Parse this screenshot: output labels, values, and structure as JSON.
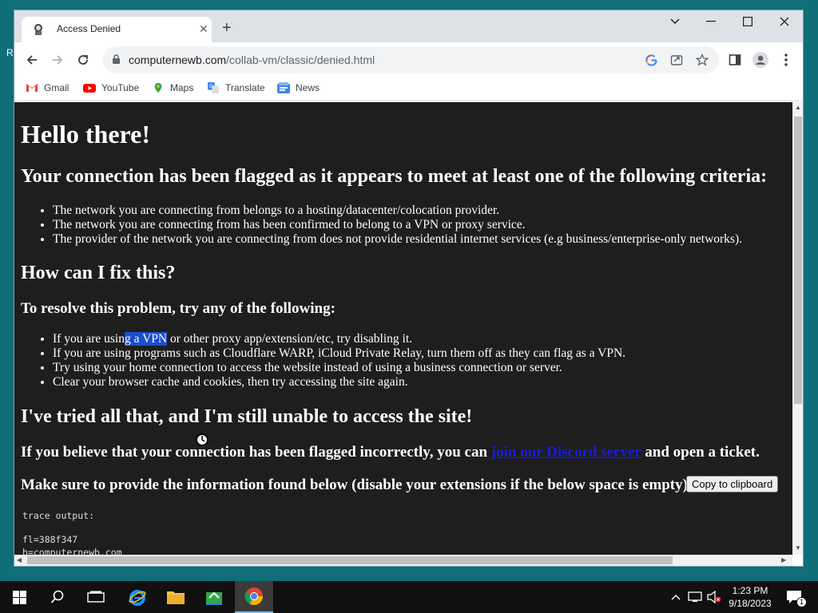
{
  "desktop": {
    "fragment_r": "R"
  },
  "browser": {
    "tab": {
      "title": "Access Denied",
      "close": "✕"
    },
    "new_tab": "+",
    "window_controls": {
      "dropdown": "⌄",
      "minimize": "—",
      "maximize": "☐",
      "close": "✕"
    },
    "url_host": "computernewb.com",
    "url_path": "/collab-vm/classic/denied.html",
    "bookmarks": [
      {
        "label": "Gmail",
        "icon": "gmail-icon"
      },
      {
        "label": "YouTube",
        "icon": "youtube-icon"
      },
      {
        "label": "Maps",
        "icon": "maps-icon"
      },
      {
        "label": "Translate",
        "icon": "translate-icon"
      },
      {
        "label": "News",
        "icon": "news-icon"
      }
    ]
  },
  "page": {
    "heading": "Hello there!",
    "flagged_heading": "Your connection has been flagged as it appears to meet at least one of the following criteria:",
    "criteria": [
      "The network you are connecting from belongs to a hosting/datacenter/colocation provider.",
      "The network you are connecting from has been confirmed to belong to a VPN or proxy service.",
      "The provider of the network you are connecting from does not provide residential internet services (e.g business/enterprise-only networks)."
    ],
    "fix_heading": "How can I fix this?",
    "resolve_heading": "To resolve this problem, try any of the following:",
    "fix_item1_pre": "If you are usin",
    "fix_item1_sel": "g a VPN",
    "fix_item1_post": " or other proxy app/extension/etc, try disabling it.",
    "fixes": [
      "If you are using programs such as Cloudflare WARP, iCloud Private Relay, turn them off as they can flag as a VPN.",
      "Try using your home connection to access the website instead of using a business connection or server.",
      "Clear your browser cache and cookies, then try accessing the site again."
    ],
    "tried_heading": "I've tried all that, and I'm still unable to access the site!",
    "ticket_pre": "If you believe that your connection has been flagged incorrectly, you can ",
    "ticket_link": "join our Discord server",
    "ticket_post": " and open a ticket.",
    "info_text": "Make sure to provide the information found below (disable your extensions if the below space is empty):",
    "copy_button": "Copy to clipboard",
    "trace_label": "trace output:",
    "trace_line1": "fl=388f347",
    "trace_line2": "h=computernewb.com"
  },
  "taskbar": {
    "time": "1:23 PM",
    "date": "9/18/2023",
    "notifications": "1"
  },
  "colors": {
    "page_bg": "#1e1e1e",
    "selection": "#1a4ed0",
    "link": "#1a1ae0",
    "desktop": "#0f6e77"
  }
}
